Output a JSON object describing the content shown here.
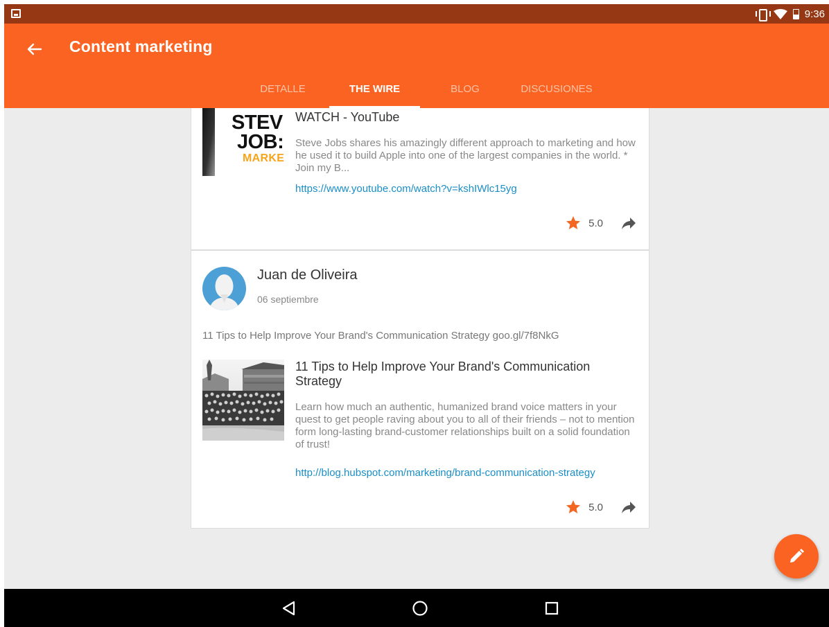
{
  "status_bar": {
    "time": "9:36",
    "icons": [
      "image-notification-icon",
      "vibrate-icon",
      "wifi-icon",
      "battery-icon"
    ]
  },
  "app_bar": {
    "title": "Content marketing",
    "back_icon": "arrow-back-icon",
    "tabs": [
      {
        "label": "DETALLE",
        "active": false
      },
      {
        "label": "THE WIRE",
        "active": true
      },
      {
        "label": "BLOG",
        "active": false
      },
      {
        "label": "DISCUSIONES",
        "active": false
      }
    ]
  },
  "posts": [
    {
      "thumbnail_text": [
        "STEV",
        "JOB:",
        "MARKETI"
      ],
      "link_title": "WATCH - YouTube",
      "link_description": "Steve Jobs shares his amazingly different approach to marketing and how he used it to build Apple into one of the largest companies in the world. * Join my B...",
      "link_url": "https://www.youtube.com/watch?v=kshIWlc15yg",
      "rating": "5.0"
    },
    {
      "author": "Juan de Oliveira",
      "date": "06 septiembre",
      "text": "11 Tips to Help Improve Your Brand's Communication Strategy goo.gl/7f8NkG",
      "link_title": "11 Tips to Help Improve Your Brand's Communication Strategy",
      "link_description": "Learn how much an authentic, humanized brand voice matters in your quest to get people raving about you to all of their friends – not to mention form long-lasting brand-customer relationships built on a solid foundation of trust!",
      "link_url": "http://blog.hubspot.com/marketing/brand-communication-strategy",
      "rating": "5.0"
    }
  ],
  "colors": {
    "primary": "#fb6322",
    "status_bar": "#963813",
    "link": "#1a8ec8",
    "star": "#f26722",
    "background": "#ececec"
  },
  "fab": {
    "icon": "pencil-icon"
  },
  "nav_bar": {
    "icons": [
      "back-triangle-icon",
      "home-circle-icon",
      "recents-square-icon"
    ]
  }
}
